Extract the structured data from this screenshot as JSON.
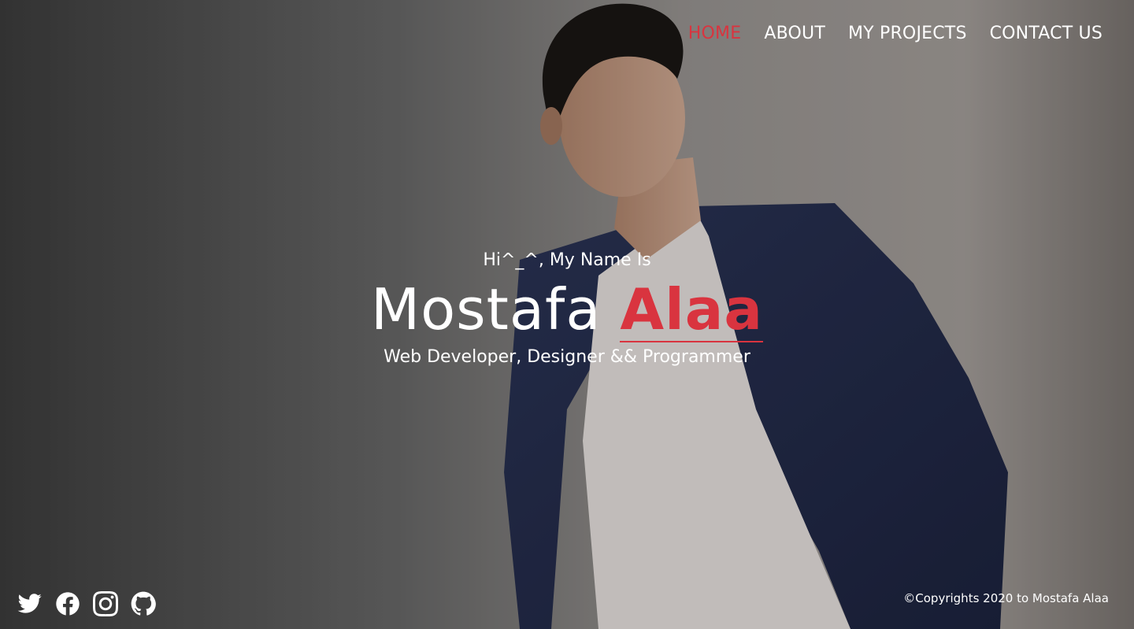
{
  "nav": {
    "items": [
      {
        "label": "HOME",
        "active": true
      },
      {
        "label": "ABOUT",
        "active": false
      },
      {
        "label": "MY PROJECTS",
        "active": false
      },
      {
        "label": "CONTACT US",
        "active": false
      }
    ]
  },
  "intro": {
    "greeting": "Hi^_^, My Name Is",
    "first_name": "Mostafa",
    "last_name": "Alaa",
    "subtitle": "Web Developer, Designer && Programmer"
  },
  "socials": [
    {
      "icon": "twitter-icon"
    },
    {
      "icon": "facebook-icon"
    },
    {
      "icon": "instagram-icon"
    },
    {
      "icon": "github-icon"
    }
  ],
  "footer": {
    "copyright": "©Copyrights 2020 to Mostafa Alaa"
  },
  "colors": {
    "accent": "#d9343f",
    "text": "#ffffff"
  }
}
